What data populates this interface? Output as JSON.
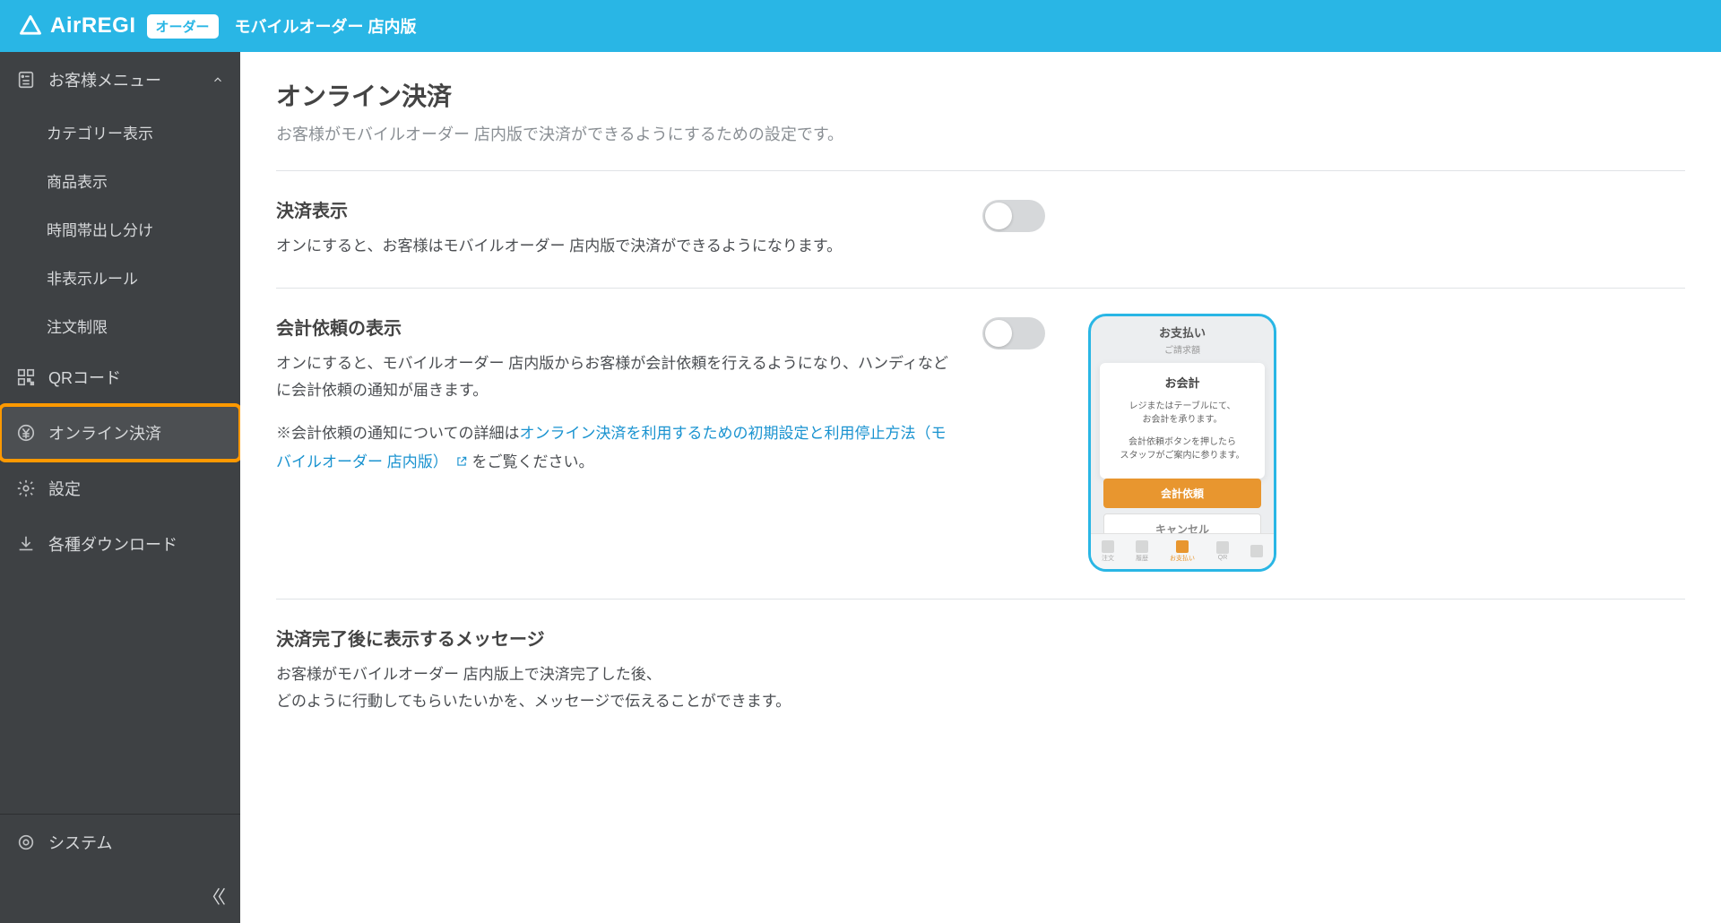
{
  "header": {
    "brand": "AirREGI",
    "badge": "オーダー",
    "title": "モバイルオーダー 店内版"
  },
  "sidebar": {
    "menu_label": "お客様メニュー",
    "sub": {
      "category": "カテゴリー表示",
      "product": "商品表示",
      "timeslot": "時間帯出し分け",
      "hidden_rules": "非表示ルール",
      "order_limit": "注文制限"
    },
    "qr": "QRコード",
    "online_payment": "オンライン決済",
    "settings": "設定",
    "downloads": "各種ダウンロード",
    "system": "システム"
  },
  "page": {
    "title": "オンライン決済",
    "desc": "お客様がモバイルオーダー 店内版で決済ができるようにするための設定です。"
  },
  "s1": {
    "title": "決済表示",
    "desc": "オンにすると、お客様はモバイルオーダー 店内版で決済ができるようになります。"
  },
  "s2": {
    "title": "会計依頼の表示",
    "desc": "オンにすると、モバイルオーダー 店内版からお客様が会計依頼を行えるようになり、ハンディなどに会計依頼の通知が届きます。",
    "note_prefix": "※会計依頼の通知についての詳細は",
    "note_link": "オンライン決済を利用するための初期設定と利用停止方法（モバイルオーダー 店内版）",
    "note_suffix": "をご覧ください。"
  },
  "s3": {
    "title": "決済完了後に表示するメッセージ",
    "desc": "お客様がモバイルオーダー 店内版上で決済完了した後、\nどのように行動してもらいたいかを、メッセージで伝えることができます。"
  },
  "preview": {
    "header": "お支払い",
    "subheader": "ご請求額",
    "dialog_title": "お会計",
    "dialog_line1": "レジまたはテーブルにて、\nお会計を承ります。",
    "dialog_line2": "会計依頼ボタンを押したら\nスタッフがご案内に参ります。",
    "btn_primary": "会計依頼",
    "btn_secondary": "キャンセル",
    "tabs": {
      "t1": "注文",
      "t2": "履歴",
      "t3": "お支払い",
      "t4": "QR",
      "t5": ""
    }
  }
}
